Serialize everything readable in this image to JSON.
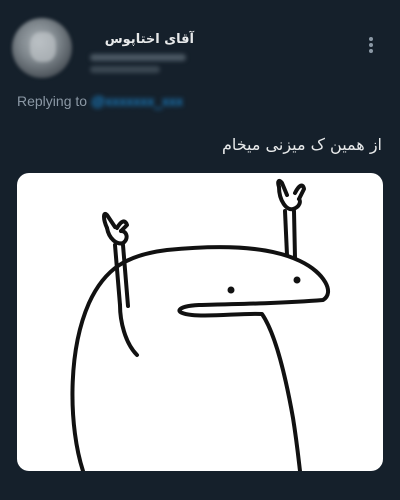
{
  "author": {
    "display_name": "آقای اختاپوس",
    "avatar_icon": "blurred-profile-photo"
  },
  "reply_context": {
    "label": "Replying to",
    "mention": "@xxxxxxx_xxx"
  },
  "tweet": {
    "text": "از همین ک میزنی میخام"
  },
  "media": {
    "description_icon": "rock-on-blob-meme"
  },
  "colors": {
    "background": "#15202b",
    "primary_text": "#e7e9ea",
    "secondary_text": "#8b98a5",
    "accent": "#1d9bf0",
    "media_background": "#ffffff"
  }
}
